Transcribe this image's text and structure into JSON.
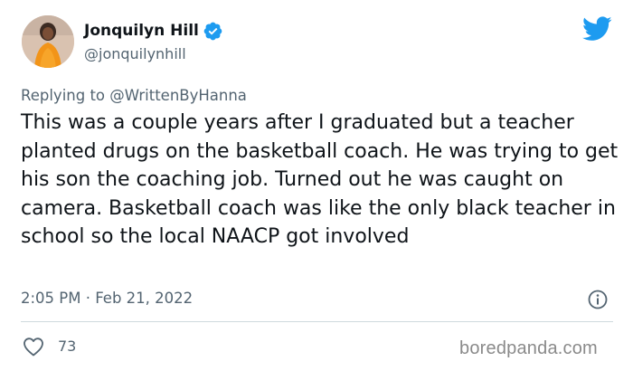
{
  "author": {
    "name": "Jonquilyn Hill",
    "handle": "@jonquilynhill"
  },
  "icons": {
    "verified": "verified-badge-icon",
    "bird": "twitter-bird-icon",
    "info": "info-icon",
    "like": "heart-icon"
  },
  "colors": {
    "verified": "#1d9bf0",
    "bird": "#1d9bf0",
    "secondary_text": "#536471",
    "divider": "#cfd9de"
  },
  "reply": {
    "prefix": "Replying to",
    "mention": "@WrittenByHanna"
  },
  "tweet": {
    "text": "This was a couple years after I graduated but a teacher planted drugs on the basketball coach. He was trying to get his son the coaching job. Turned out he was caught on camera. Basketball coach was like the only black teacher in school so the local NAACP got involved",
    "timestamp": "2:05 PM · Feb 21, 2022"
  },
  "engagement": {
    "likes": "73"
  },
  "watermark": "boredpanda.com"
}
